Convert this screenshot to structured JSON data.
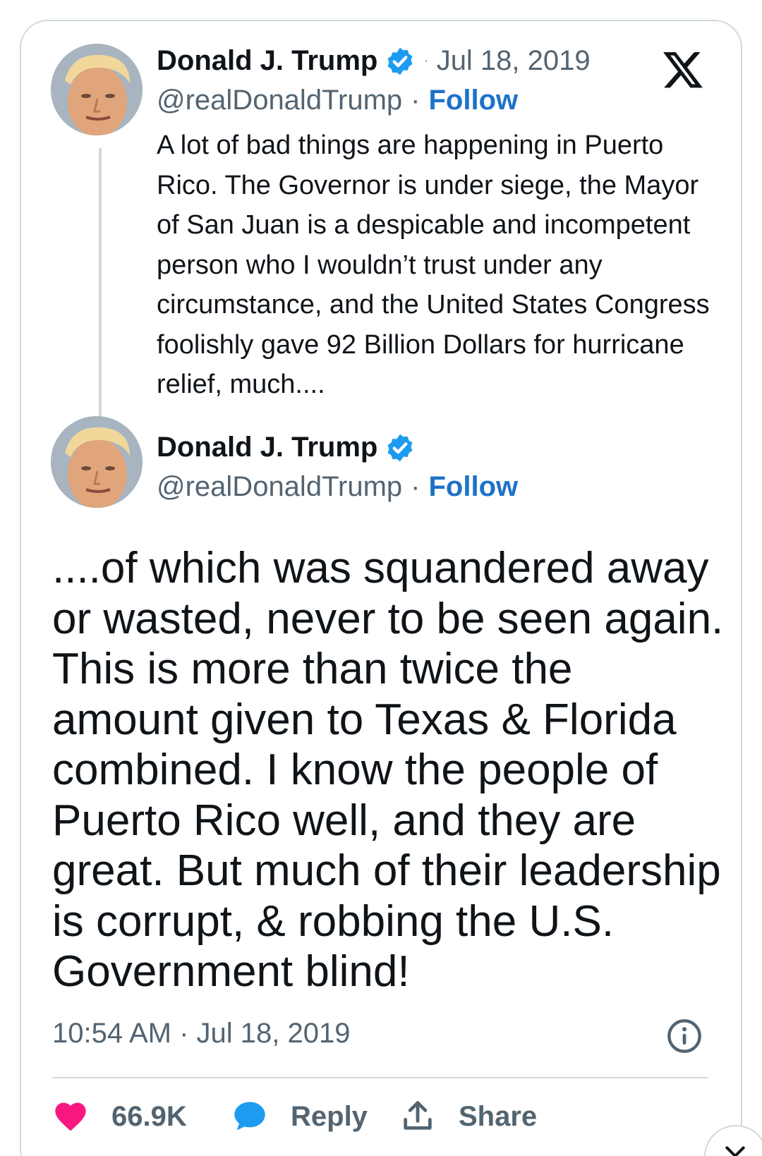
{
  "colors": {
    "accent": "#1d9bf0",
    "follow": "#1d72c8",
    "like": "#f91880",
    "muted": "#536471",
    "text": "#0f1419",
    "border": "#cfd9de"
  },
  "brand": {
    "logo_icon": "x-logo-icon"
  },
  "tweets": [
    {
      "author": "Donald J. Trump",
      "verified_icon": "verified-badge-icon",
      "handle": "@realDonaldTrump",
      "date": "Jul 18, 2019",
      "follow_label": "Follow",
      "text": "A lot of bad things are happening in Puerto Rico. The Governor is under siege, the Mayor of San Juan is a despicable and incompetent person who I wouldn’t trust under any circumstance, and the United States Congress foolishly gave 92 Billion Dollars for hurricane relief, much...."
    },
    {
      "author": "Donald J. Trump",
      "verified_icon": "verified-badge-icon",
      "handle": "@realDonaldTrump",
      "follow_label": "Follow",
      "text": "....of which was squandered away or wasted, never to be seen again. This is more than twice the amount given to Texas & Florida combined. I know the people of Puerto Rico well, and they are great. But much of their leadership is corrupt, & robbing the U.S. Government blind!",
      "timestamp": "10:54 AM · Jul 18, 2019"
    }
  ],
  "separator": "·",
  "actions": {
    "likes_count": "66.9K",
    "reply_label": "Reply",
    "share_label": "Share"
  }
}
